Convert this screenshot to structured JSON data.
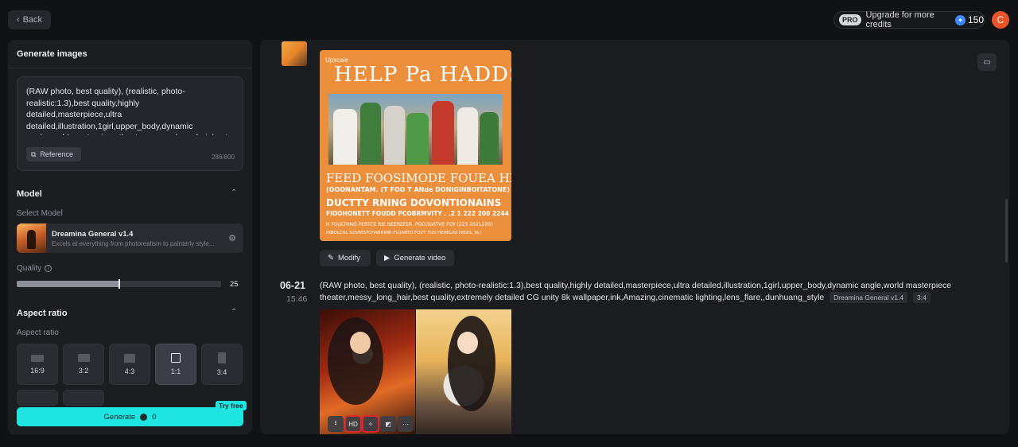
{
  "topbar": {
    "back_label": "Back",
    "pro_tag": "PRO",
    "upgrade_text": "Upgrade for more credits",
    "credits": "150",
    "avatar_letter": "C"
  },
  "left_panel": {
    "title": "Generate images",
    "prompt_text": "(RAW photo, best quality), (realistic, photo-realistic:1.3),best quality,highly detailed,masterpiece,ultra detailed,illustration,1girl,upper_body,dynamic angle,world masterpiece theater,messy_long_hair,best",
    "reference_label": "Reference",
    "char_count": "286/800",
    "model_section_title": "Model",
    "select_model_label": "Select Model",
    "model_name": "Dreamina General v1.4",
    "model_desc": "Excels at everything from photorealism to painterly style...",
    "quality_label": "Quality",
    "quality_value": "25",
    "quality_fraction": 0.5,
    "aspect_section_title": "Aspect ratio",
    "aspect_sub_label": "Aspect ratio",
    "ratios": [
      "16:9",
      "3:2",
      "4:3",
      "1:1",
      "3:4"
    ],
    "selected_ratio": "1:1",
    "generate_label": "Generate",
    "generate_credits": "0",
    "try_free": "Try free"
  },
  "main": {
    "poster": {
      "upscale_label": "Upscale",
      "headline": "HELP Pa HADDSS",
      "line1": "FEED FOOSIMODE FOUEA HEQDT",
      "line2": "(OOONANTAM. (T FOO T ANde DONIGINBOITATONE)",
      "line3": "DUCTTY RNING DOVONTIONAINS",
      "line4": "FIOOHONETT FOUDD PCOBRMVITY . .2 1 222 200 2244",
      "line5": "H FOULTHNO PERTCE RIE NEEREFER. POCOLVITVE FOY (223 2021220)",
      "line6": "HIBOLCAL SOVNISTCHARHIME-FLUARTO FO2T TUS HERELAS HISIIS, SL!"
    },
    "modify_label": "Modify",
    "generate_video_label": "Generate video",
    "entry": {
      "date": "06-21",
      "time": "15:46",
      "prompt": "(RAW photo, best quality), (realistic, photo-realistic:1.3),best quality,highly detailed,masterpiece,ultra detailed,illustration,1girl,upper_body,dynamic angle,world masterpiece theater,messy_long_hair,best quality,extremely detailed CG unity 8k wallpaper,ink,Amazing,cinematic lighting,lens_flare,,dunhuang_style",
      "model_tag": "Dreamina General v1.4",
      "ratio_tag": "3:4"
    },
    "overlay": {
      "download_icon": "download-icon",
      "hd_label": "HD",
      "more_label": "···"
    }
  }
}
